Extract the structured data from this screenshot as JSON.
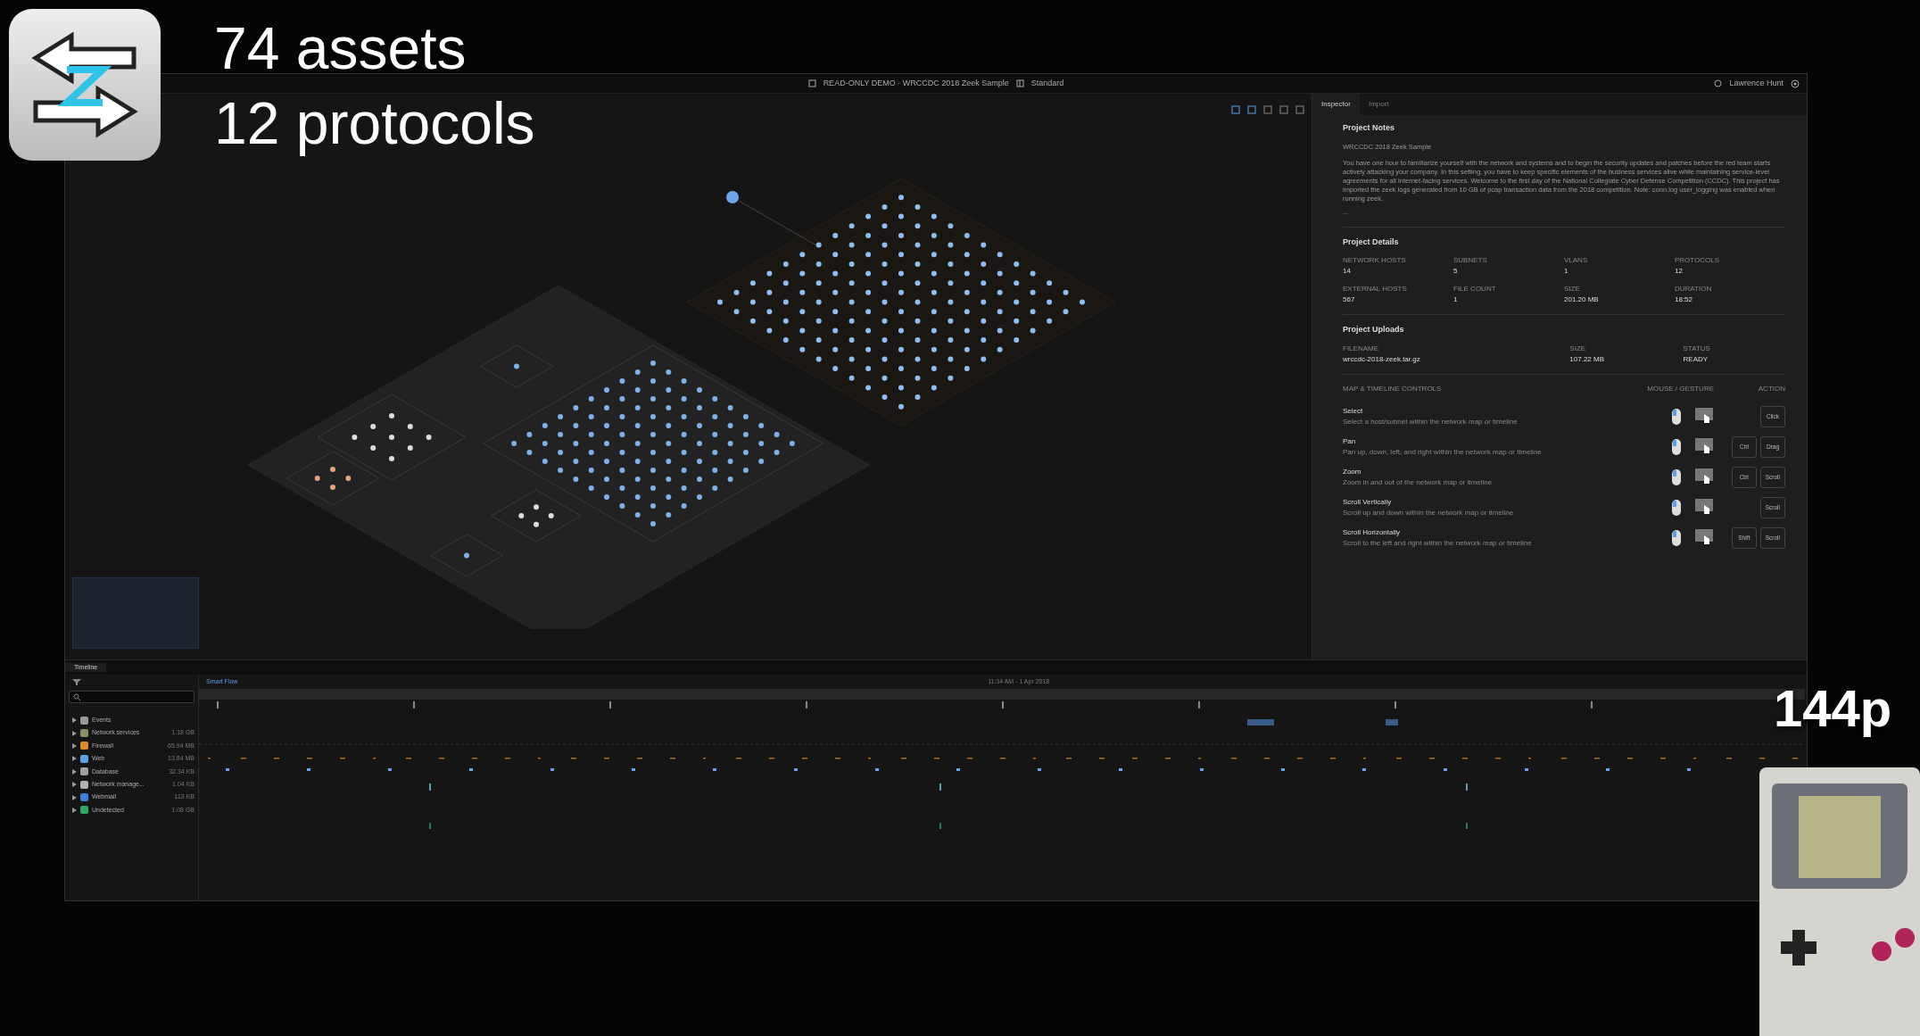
{
  "overlay": {
    "lines": [
      "74 assets",
      "12 protocols"
    ],
    "badge": "144p"
  },
  "window": {
    "title": "READ-ONLY DEMO · WRCCDC 2018 Zeek Sample",
    "mode": "Standard",
    "user": "Lawrence Hunt"
  },
  "inspector": {
    "tabs": [
      {
        "label": "Inspector",
        "selected": true
      },
      {
        "label": "Import",
        "selected": false
      }
    ],
    "notes": {
      "heading": "Project Notes",
      "subtitle": "WRCCDC 2018 Zeek Sample",
      "body": "You have one hour to familiarize yourself with the network and systems and to begin the security updates and patches before the red team starts actively attacking your company. In this setting, you have to keep specific elements of the business services alive while maintaining service-level agreements for all internet-facing services. Welcome to the first day of the National Collegiate Cyber Defense Competition (CCDC). This project has imported the zeek logs generated from 10 GB of pcap transaction data from the 2018 competition. Note: conn.log user_logging was enabled when running zeek.",
      "more": "..."
    },
    "details": {
      "heading": "Project Details",
      "items": [
        {
          "label": "NETWORK HOSTS",
          "value": "14"
        },
        {
          "label": "SUBNETS",
          "value": "5"
        },
        {
          "label": "VLANS",
          "value": "1"
        },
        {
          "label": "PROTOCOLS",
          "value": "12"
        },
        {
          "label": "EXTERNAL HOSTS",
          "value": "567"
        },
        {
          "label": "FILE COUNT",
          "value": "1"
        },
        {
          "label": "SIZE",
          "value": "201.20 MB"
        },
        {
          "label": "DURATION",
          "value": "18:52"
        }
      ]
    },
    "uploads": {
      "heading": "Project Uploads",
      "columns": [
        {
          "label": "FILENAME",
          "value": "wrccdc-2018-zeek.tar.gz"
        },
        {
          "label": "SIZE",
          "value": "107.22 MB"
        },
        {
          "label": "STATUS",
          "value": "READY"
        }
      ]
    },
    "controls": {
      "heading": "MAP & TIMELINE CONTROLS",
      "gesture_heading": "MOUSE / GESTURE",
      "action_heading": "ACTION",
      "rows": [
        {
          "name": "Select",
          "description": "Select a host/subnet within the network map or timeline",
          "keys": [
            "Click"
          ]
        },
        {
          "name": "Pan",
          "description": "Pan up, down, left, and right within the network map or timeline",
          "keys": [
            "Ctrl",
            "Drag"
          ]
        },
        {
          "name": "Zoom",
          "description": "Zoom in and out of the network map or timeline",
          "keys": [
            "Ctrl",
            "Scroll"
          ]
        },
        {
          "name": "Scroll Vertically",
          "description": "Scroll up and down within the network map or timeline",
          "keys": [
            "Scroll"
          ]
        },
        {
          "name": "Scroll Horizontally",
          "description": "Scroll to the left and right within the network map or timeline",
          "keys": [
            "Shift",
            "Scroll"
          ]
        }
      ]
    }
  },
  "timeline": {
    "tab": "Timeline",
    "flow": "Smart Flow",
    "range": "11:34 AM - 1 Apr 2018",
    "rows": [
      {
        "label": "Events",
        "size": "",
        "color": "#9a9a9a"
      },
      {
        "label": "Network services",
        "size": "1.18 GB",
        "color": "#8a8f6a"
      },
      {
        "label": "Firewall",
        "size": "65.94 MB",
        "color": "#e08a2c"
      },
      {
        "label": "Web",
        "size": "13.84 MB",
        "color": "#5aa0e6"
      },
      {
        "label": "Database",
        "size": "32.34 KB",
        "color": "#a0a0a0"
      },
      {
        "label": "Network manage...",
        "size": "1.04 KB",
        "color": "#b0b0b0"
      },
      {
        "label": "Webmail",
        "size": "113 KB",
        "color": "#3a7fd8"
      },
      {
        "label": "Undetected",
        "size": "1.08 GB",
        "color": "#2fa86a"
      }
    ]
  }
}
